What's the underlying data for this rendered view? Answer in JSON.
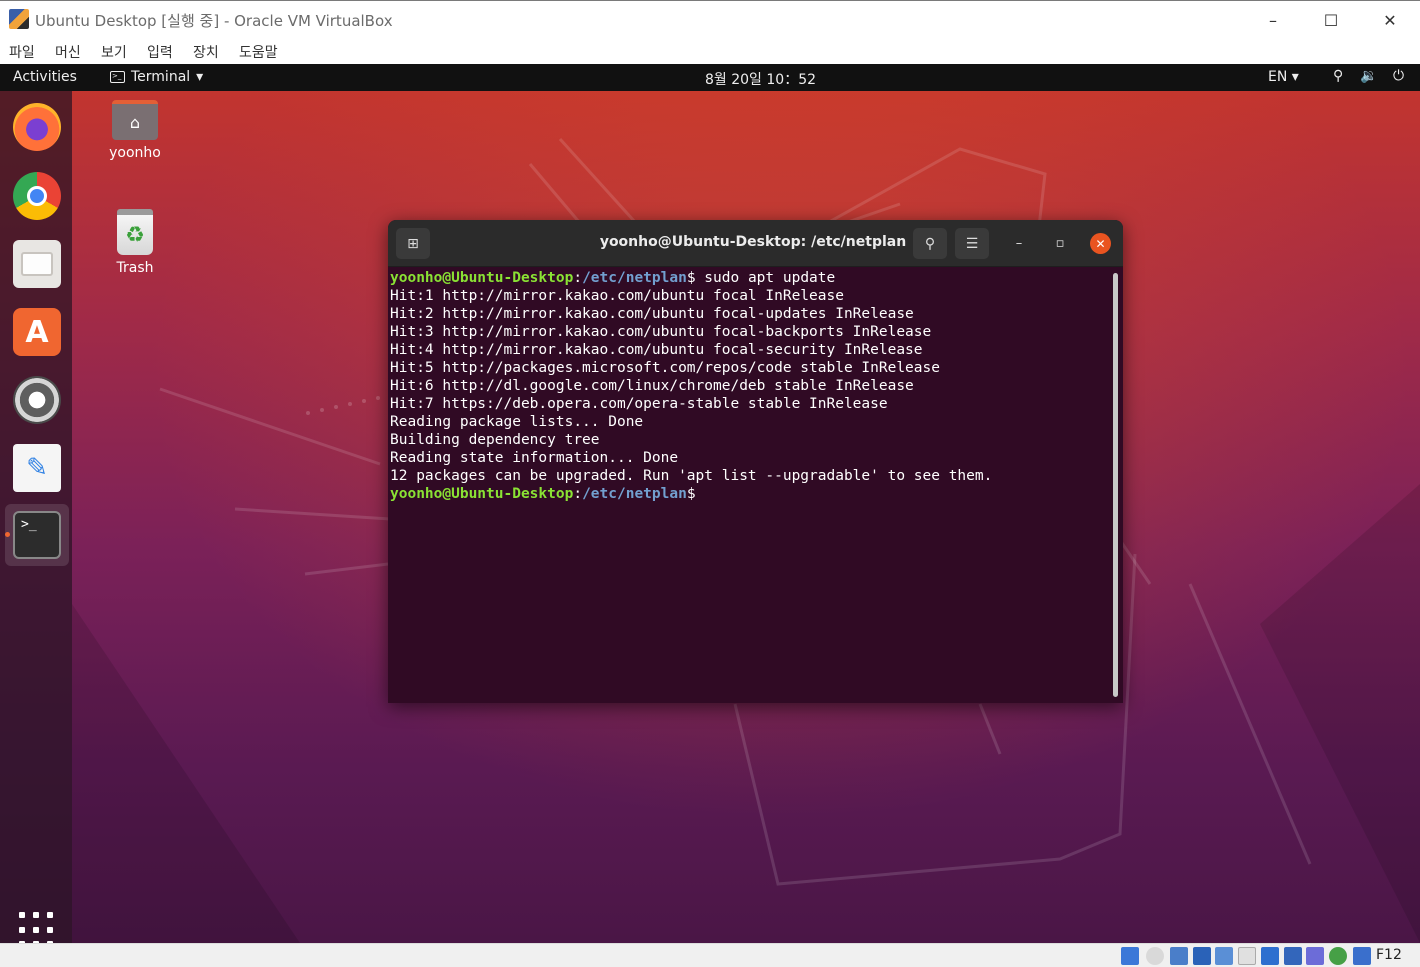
{
  "vbox": {
    "title": "Ubuntu Desktop [실행 중] - Oracle VM VirtualBox",
    "controls": {
      "minimize": "–",
      "maximize": "☐",
      "close": "✕"
    },
    "menu": [
      "파일",
      "머신",
      "보기",
      "입력",
      "장치",
      "도움말"
    ],
    "host_key": "F12"
  },
  "topbar": {
    "activities": "Activities",
    "app_menu": "Terminal",
    "app_menu_arrow": "▾",
    "clock": "8월 20일  10：52",
    "language": "EN ▾",
    "network_icon": "network-icon",
    "volume_icon": "volume-icon",
    "power_icon": "power-icon"
  },
  "dock": {
    "items": [
      "firefox-icon",
      "chrome-icon",
      "files-icon",
      "software-icon",
      "settings-icon",
      "text-editor-icon",
      "terminal-icon"
    ],
    "show_apps_icon": "show-apps-icon"
  },
  "desktop": {
    "icons": [
      {
        "label": "yoonho",
        "icon": "home-folder-icon"
      },
      {
        "label": "Trash",
        "icon": "trash-icon"
      }
    ]
  },
  "terminal": {
    "title": "yoonho@Ubuntu-Desktop: /etc/netplan",
    "prompt_user": "yoonho@Ubuntu-Desktop",
    "prompt_path": "/etc/netplan",
    "command": " sudo apt update",
    "output": [
      "Hit:1 http://mirror.kakao.com/ubuntu focal InRelease",
      "Hit:2 http://mirror.kakao.com/ubuntu focal-updates InRelease",
      "Hit:3 http://mirror.kakao.com/ubuntu focal-backports InRelease",
      "Hit:4 http://mirror.kakao.com/ubuntu focal-security InRelease",
      "Hit:5 http://packages.microsoft.com/repos/code stable InRelease",
      "Hit:6 http://dl.google.com/linux/chrome/deb stable InRelease",
      "Hit:7 https://deb.opera.com/opera-stable stable InRelease",
      "Reading package lists... Done",
      "Building dependency tree",
      "Reading state information... Done",
      "12 packages can be upgraded. Run 'apt list --upgradable' to see them."
    ]
  },
  "colors": {
    "accent": "#e95420",
    "prompt_user": "#8ae234",
    "prompt_path": "#729fcf",
    "terminal_bg": "#300a24"
  }
}
